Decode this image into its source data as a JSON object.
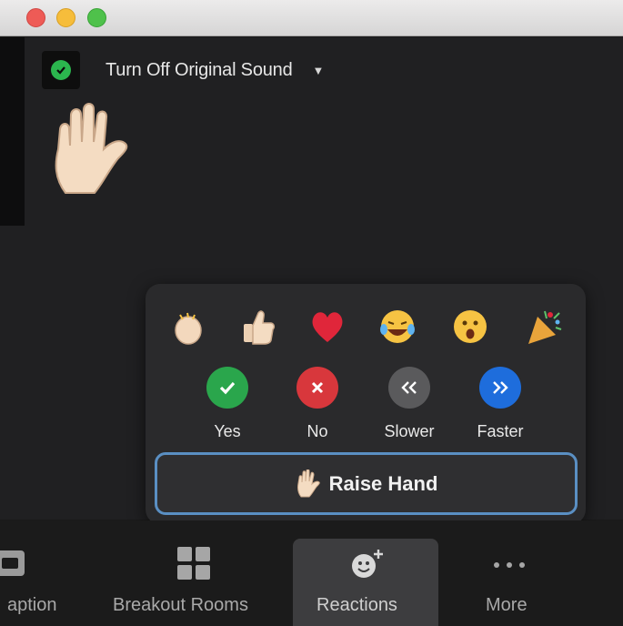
{
  "window": {
    "controls": [
      "close",
      "minimize",
      "zoom"
    ]
  },
  "video": {
    "original_sound_label": "Turn Off Original Sound",
    "original_sound_icon": "shield-check-icon",
    "raised_hand_icon": "raised-hand-icon"
  },
  "reactions_popup": {
    "emojis": [
      {
        "name": "clapping-hands-icon"
      },
      {
        "name": "thumbs-up-icon"
      },
      {
        "name": "heart-icon"
      },
      {
        "name": "tears-of-joy-icon"
      },
      {
        "name": "open-mouth-icon"
      },
      {
        "name": "party-popper-icon"
      }
    ],
    "feedback": [
      {
        "label": "Yes",
        "icon": "check-icon",
        "color": "#2aa64c"
      },
      {
        "label": "No",
        "icon": "x-icon",
        "color": "#d8373c"
      },
      {
        "label": "Slower",
        "icon": "slower-icon",
        "color": "#5a5a5c"
      },
      {
        "label": "Faster",
        "icon": "faster-icon",
        "color": "#1e6ddc"
      }
    ],
    "raise_hand_label": "Raise Hand"
  },
  "toolbar": {
    "items": [
      {
        "label": "aption",
        "icon": "caption-icon"
      },
      {
        "label": "Breakout Rooms",
        "icon": "breakout-rooms-icon"
      },
      {
        "label": "Reactions",
        "icon": "reactions-icon",
        "active": true
      },
      {
        "label": "More",
        "icon": "more-icon"
      }
    ]
  },
  "colors": {
    "background": "#202022",
    "popup": "#2a2a2c",
    "raise_hand_border": "#5a8fc3",
    "active_tab": "#3d3d3f"
  }
}
